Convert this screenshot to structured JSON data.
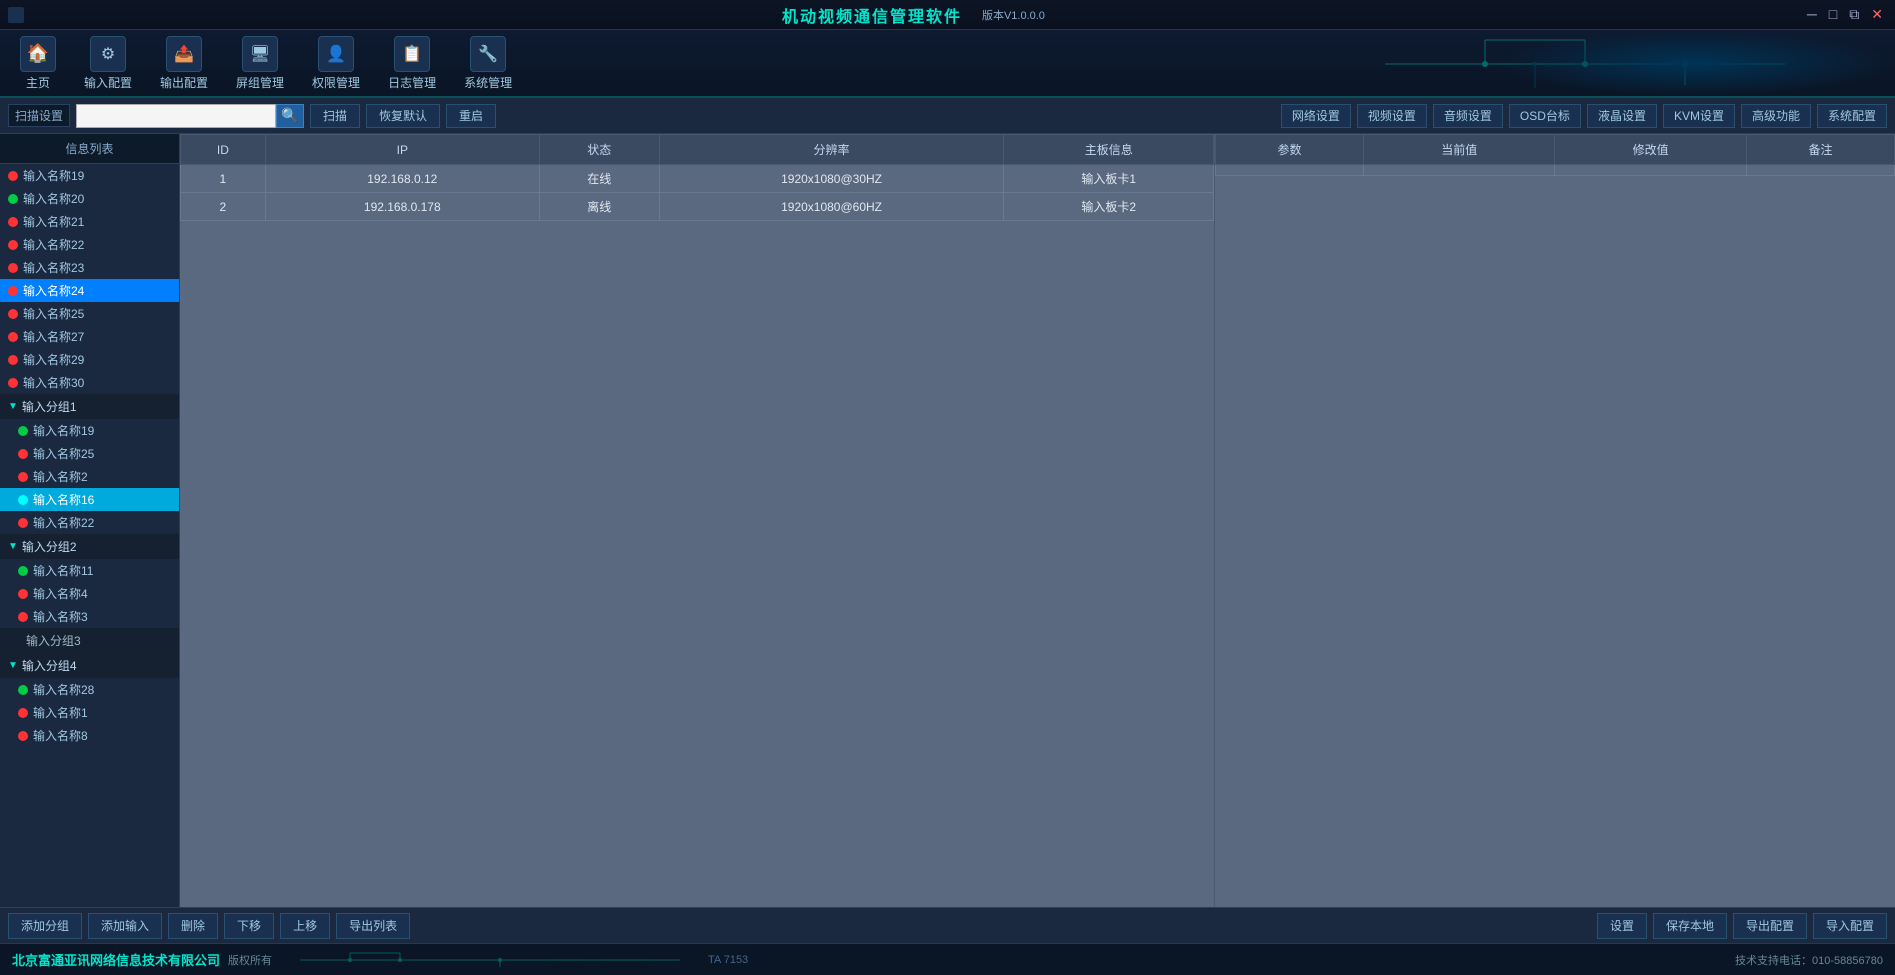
{
  "app": {
    "title": "机动视频通信管理软件",
    "version": "版本V1.0.0.0"
  },
  "titlebar": {
    "minimize": "─",
    "maximize": "□",
    "close": "✕",
    "restore": "⧉"
  },
  "navbar": {
    "items": [
      {
        "id": "home",
        "label": "主页",
        "icon": "🏠"
      },
      {
        "id": "input-config",
        "label": "输入配置",
        "icon": "⚙"
      },
      {
        "id": "output-config",
        "label": "输出配置",
        "icon": "📤"
      },
      {
        "id": "screen-mgmt",
        "label": "屏组管理",
        "icon": "🖥"
      },
      {
        "id": "perm-mgmt",
        "label": "权限管理",
        "icon": "👤"
      },
      {
        "id": "log-mgmt",
        "label": "日志管理",
        "icon": "📋"
      },
      {
        "id": "sys-config",
        "label": "系统管理",
        "icon": "🔧"
      }
    ]
  },
  "toolbar": {
    "scan_label": "扫描设置",
    "scan_btn": "扫描",
    "restore_btn": "恢复默认",
    "reset_btn": "重启",
    "config_btns": [
      "网络设置",
      "视频设置",
      "音频设置",
      "OSD台标",
      "液晶设置",
      "KVM设置",
      "高级功能",
      "系统配置"
    ]
  },
  "left_panel": {
    "header": "信息列表",
    "items": [
      {
        "name": "输入名称19",
        "status": "red",
        "active": false
      },
      {
        "name": "输入名称20",
        "status": "green",
        "active": false
      },
      {
        "name": "输入名称21",
        "status": "red",
        "active": false
      },
      {
        "name": "输入名称22",
        "status": "red",
        "active": false
      },
      {
        "name": "输入名称23",
        "status": "red",
        "active": false
      },
      {
        "name": "输入名称24",
        "status": "red",
        "active": true,
        "style": "blue-bg"
      },
      {
        "name": "输入名称25",
        "status": "red",
        "active": false
      },
      {
        "name": "输入名称27",
        "status": "red",
        "active": false
      },
      {
        "name": "输入名称29",
        "status": "red",
        "active": false
      },
      {
        "name": "输入名称30",
        "status": "red",
        "active": false
      }
    ],
    "groups": [
      {
        "name": "输入分组1",
        "expanded": true,
        "items": [
          {
            "name": "输入名称19",
            "status": "green",
            "active": false
          },
          {
            "name": "输入名称25",
            "status": "red",
            "active": false
          },
          {
            "name": "输入名称2",
            "status": "red",
            "active": false
          },
          {
            "name": "输入名称16",
            "status": "blue",
            "active": true,
            "style": "cyan-bg"
          },
          {
            "name": "输入名称22",
            "status": "red",
            "active": false
          }
        ]
      },
      {
        "name": "输入分组2",
        "expanded": true,
        "items": [
          {
            "name": "输入名称11",
            "status": "green",
            "active": false
          },
          {
            "name": "输入名称4",
            "status": "red",
            "active": false
          },
          {
            "name": "输入名称3",
            "status": "red",
            "active": false
          }
        ]
      },
      {
        "name": "输入分组3",
        "expanded": false,
        "items": []
      },
      {
        "name": "输入分组4",
        "expanded": true,
        "items": [
          {
            "name": "输入名称28",
            "status": "green",
            "active": false
          },
          {
            "name": "输入名称1",
            "status": "red",
            "active": false
          },
          {
            "name": "输入名称8",
            "status": "red",
            "active": false
          }
        ]
      }
    ]
  },
  "table": {
    "headers": [
      "ID",
      "IP",
      "状态",
      "分辨率",
      "主板信息"
    ],
    "rows": [
      {
        "id": "1",
        "ip": "192.168.0.12",
        "status": "在线",
        "resolution": "1920x1080@30HZ",
        "board": "输入板卡1"
      },
      {
        "id": "2",
        "ip": "192.168.0.178",
        "status": "离线",
        "resolution": "1920x1080@60HZ",
        "board": "输入板卡2"
      }
    ]
  },
  "right_table": {
    "headers": [
      "参数",
      "当前值",
      "修改值",
      "备注"
    ]
  },
  "bottom_toolbar": {
    "buttons_left": [
      "添加分组",
      "添加输入",
      "删除",
      "下移",
      "上移",
      "导出列表"
    ],
    "buttons_right": [
      "设置",
      "保存本地",
      "导出配置",
      "导入配置"
    ]
  },
  "statusbar": {
    "company": "北京富通亚讯网络信息技术有限公司",
    "copyright": "版权所有",
    "notice": "TA 7153",
    "support": "技术支持电话：010-58856780"
  }
}
